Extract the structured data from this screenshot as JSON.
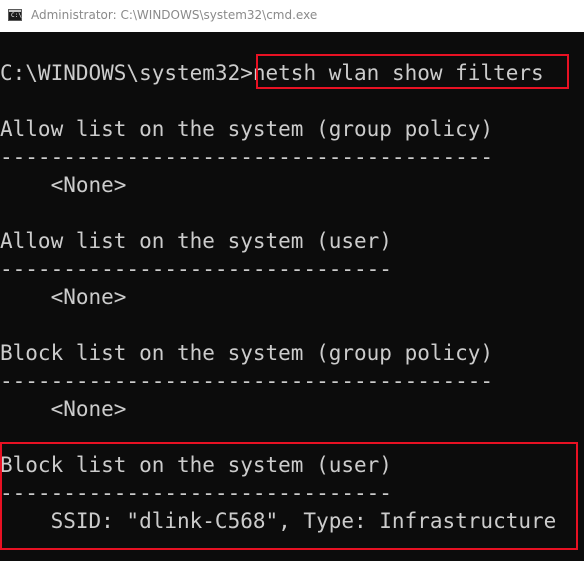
{
  "window": {
    "title": "Administrator: C:\\WINDOWS\\system32\\cmd.exe",
    "icon": "cmd-icon",
    "icon_text": "C:\\_"
  },
  "console": {
    "prompt": "C:\\WINDOWS\\system32>",
    "command": "netsh wlan show filters",
    "lines": [
      "Allow list on the system (group policy)",
      "---------------------------------------",
      "    <None>",
      "Allow list on the system (user)",
      "-------------------------------",
      "    <None>",
      "Block list on the system (group policy)",
      "---------------------------------------",
      "    <None>",
      "Block list on the system (user)",
      "-------------------------------",
      "    SSID: \"dlink-C568\", Type: Infrastructure"
    ]
  },
  "colors": {
    "background": "#0c0c0c",
    "text": "#cccccc",
    "highlight": "#e81123"
  }
}
